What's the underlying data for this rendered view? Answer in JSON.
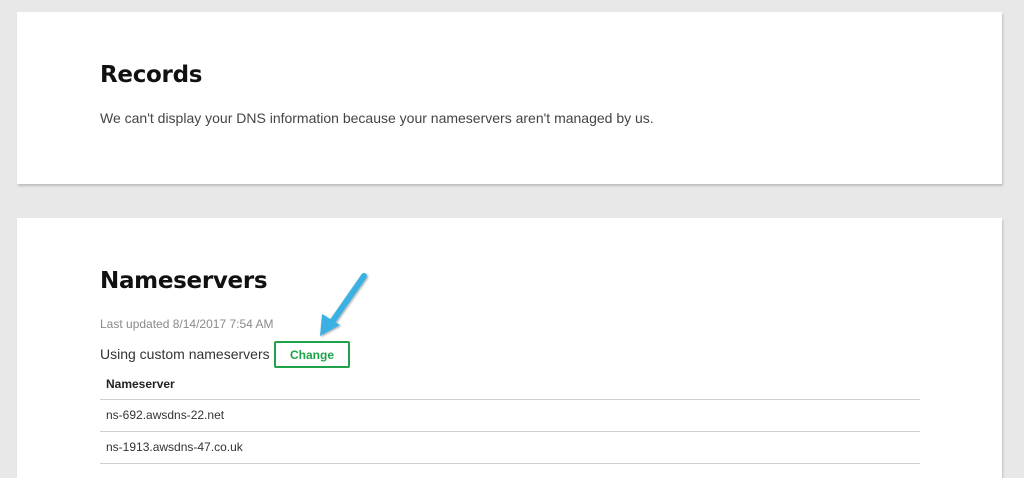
{
  "records": {
    "title": "Records",
    "description": "We can't display your DNS information because your nameservers aren't managed by us."
  },
  "nameservers": {
    "title": "Nameservers",
    "last_updated": "Last updated 8/14/2017 7:54 AM",
    "status_text": "Using custom nameservers",
    "change_label": "Change",
    "table": {
      "header": "Nameserver",
      "rows": [
        "ns-692.awsdns-22.net",
        "ns-1913.awsdns-47.co.uk"
      ]
    }
  },
  "colors": {
    "accent_green": "#1fa34a",
    "annotation_arrow": "#3ab0e2"
  },
  "icons": {
    "annotation": "annotation-arrow-icon"
  }
}
